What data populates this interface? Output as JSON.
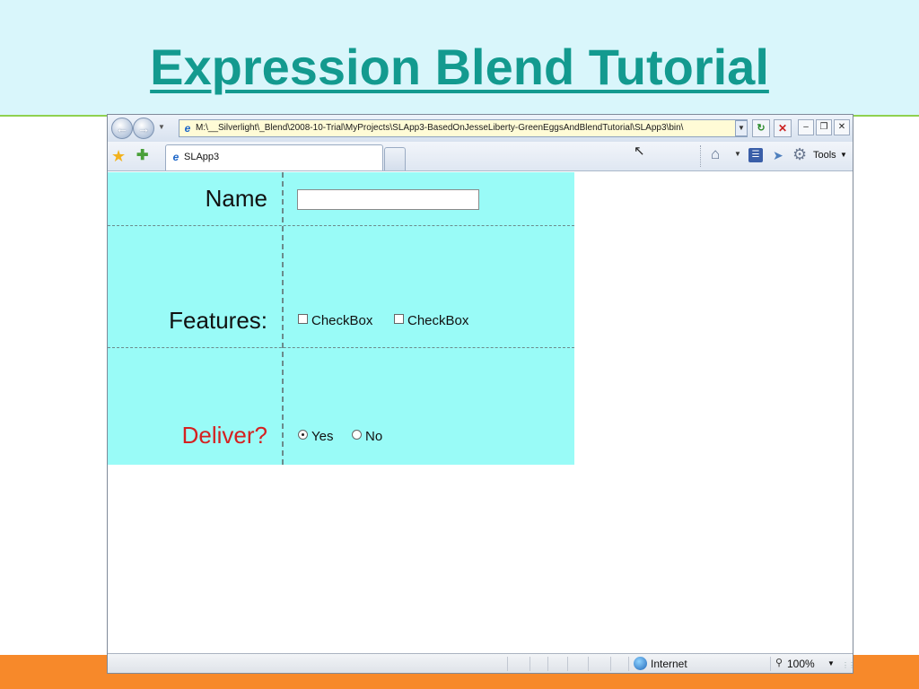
{
  "slide": {
    "title": "Expression Blend Tutorial",
    "colors": {
      "header_bg": "#d9f6fb",
      "title": "#139a8f",
      "footer": "#f7892a",
      "accent_line": "#8fd14f"
    }
  },
  "browser": {
    "address": "M:\\__Silverlight\\_Blend\\2008-10-Trial\\MyProjects\\SLApp3-BasedOnJesseLiberty-GreenEggsAndBlendTutorial\\SLApp3\\bin\\",
    "tab_title": "SLApp3",
    "tools_label": "Tools",
    "icons": [
      "back-icon",
      "forward-icon",
      "refresh-icon",
      "stop-icon",
      "favorites-star-icon",
      "add-favorite-icon",
      "home-icon",
      "feeds-icon",
      "research-icon",
      "gear-icon"
    ],
    "status": {
      "zone": "Internet",
      "zoom": "100%"
    }
  },
  "form": {
    "name_label": "Name",
    "name_value": "",
    "features_label": "Features:",
    "checkboxes": [
      {
        "label": "CheckBox",
        "checked": false
      },
      {
        "label": "CheckBox",
        "checked": false
      }
    ],
    "deliver_label": "Deliver?",
    "radios": [
      {
        "label": "Yes",
        "selected": true
      },
      {
        "label": "No",
        "selected": false
      }
    ],
    "colors": {
      "panel_bg": "#99fbf7",
      "deliver_label": "#d42121"
    }
  }
}
